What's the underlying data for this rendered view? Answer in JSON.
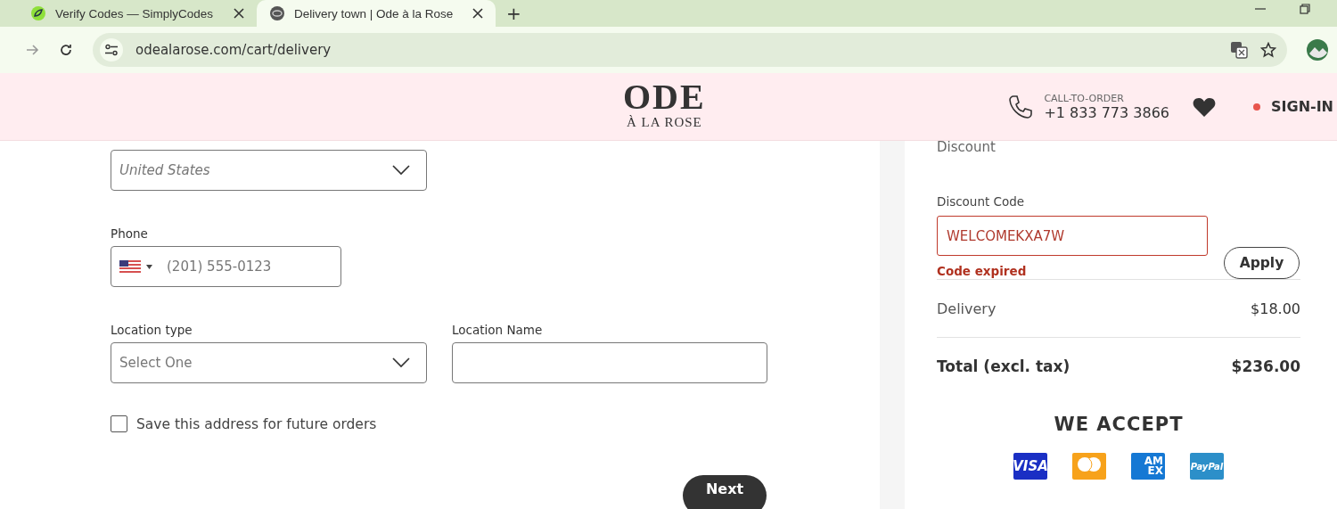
{
  "browser": {
    "tabs": [
      {
        "title": "Verify Codes — SimplyCodes",
        "selected": false
      },
      {
        "title": "Delivery town | Ode à la Rose",
        "selected": true
      }
    ],
    "new_tab": "+",
    "url": "odealarose.com/cart/delivery"
  },
  "header": {
    "logo_top": "ODE",
    "logo_bottom": "À LA ROSE",
    "call_label": "CALL-TO-ORDER",
    "phone": "+1 833 773 3866",
    "sign_in": "SIGN-IN"
  },
  "form": {
    "country": {
      "value": "United States"
    },
    "phone": {
      "label": "Phone",
      "placeholder": "(201) 555-0123"
    },
    "location_type": {
      "label": "Location type",
      "placeholder": "Select One"
    },
    "location_name": {
      "label": "Location Name"
    },
    "save_address": {
      "label": "Save this address for future orders",
      "checked": false
    },
    "next": "Next"
  },
  "summary": {
    "discount_heading": "Discount",
    "discount_code": {
      "label": "Discount Code",
      "value": "WELCOMEKXA7W",
      "error": "Code expired"
    },
    "apply": "Apply",
    "lines": [
      {
        "label": "Delivery",
        "amount": "$18.00",
        "kind": "line"
      },
      {
        "label": "Total (excl. tax)",
        "amount": "$236.00",
        "kind": "total"
      }
    ],
    "accept_heading": "WE ACCEPT",
    "cards": [
      {
        "kind": "visa",
        "text": "VISA"
      },
      {
        "kind": "mastercard"
      },
      {
        "kind": "amex",
        "text": "AM EX"
      },
      {
        "kind": "paypal",
        "text": "PayPal"
      }
    ]
  }
}
